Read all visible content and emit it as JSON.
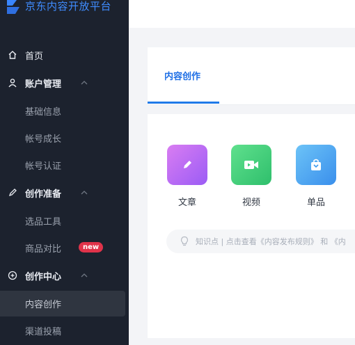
{
  "sidebar": {
    "logo_text": "京东内容开放平台",
    "items": [
      {
        "label": "首页",
        "icon": "home-icon"
      },
      {
        "label": "账户管理",
        "icon": "user-icon"
      },
      {
        "label": "基础信息"
      },
      {
        "label": "帐号成长"
      },
      {
        "label": "帐号认证"
      },
      {
        "label": "创作准备",
        "icon": "pen-icon"
      },
      {
        "label": "选品工具"
      },
      {
        "label": "商品对比",
        "badge": "new"
      },
      {
        "label": "创作中心",
        "icon": "create-center-icon"
      },
      {
        "label": "内容创作"
      },
      {
        "label": "渠道投稿"
      }
    ]
  },
  "main": {
    "tab_label": "内容创作",
    "content_types": [
      {
        "label": "文章",
        "icon": "article-icon",
        "color": "#c266f5"
      },
      {
        "label": "视频",
        "icon": "video-icon",
        "color": "#3fcf7a"
      },
      {
        "label": "单品",
        "icon": "product-bag-icon",
        "color": "#3c9cf0"
      }
    ],
    "tip_text": "知识点 | 点击查看《内容发布规则》 和 《内"
  },
  "colors": {
    "sidebar_bg": "#1c222e",
    "accent": "#1f7ae8",
    "badge": "#e0334a"
  }
}
